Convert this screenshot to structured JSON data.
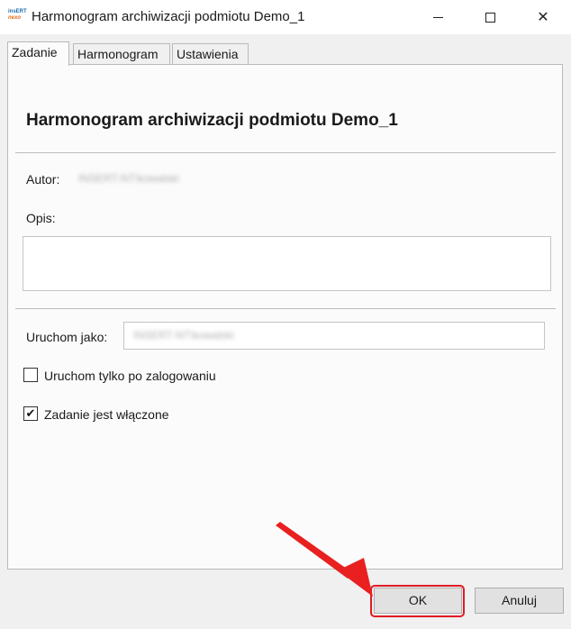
{
  "window": {
    "title": "Harmonogram archiwizacji podmiotu Demo_1",
    "app_icon_text_top": "insERT",
    "app_icon_text_bottom": "nexo",
    "close_glyph": "✕"
  },
  "tabs": [
    {
      "label": "Zadanie",
      "active": true
    },
    {
      "label": "Harmonogram",
      "active": false
    },
    {
      "label": "Ustawienia",
      "active": false
    }
  ],
  "form": {
    "heading": "Harmonogram archiwizacji podmiotu Demo_1",
    "autor_label": "Autor:",
    "autor_value": "INSERT-NT\\kowalski",
    "opis_label": "Opis:",
    "opis_value": "",
    "run_as_label": "Uruchom jako:",
    "run_as_value": "INSERT-NT\\kowalski",
    "only_logged_label": "Uruchom tylko po zalogowaniu",
    "only_logged_checked": false,
    "enabled_label": "Zadanie jest włączone",
    "enabled_checked": true,
    "check_glyph": "✔"
  },
  "buttons": {
    "ok_label": "OK",
    "cancel_label": "Anuluj"
  },
  "colors": {
    "highlight": "#e01b24",
    "arrow": "#e82020"
  }
}
